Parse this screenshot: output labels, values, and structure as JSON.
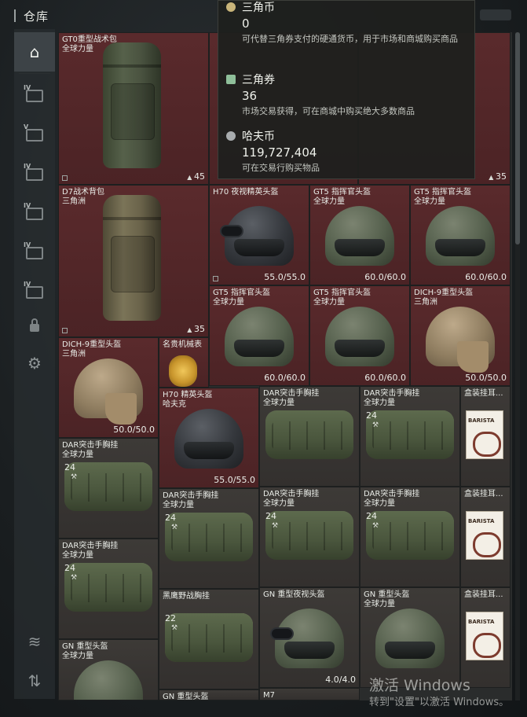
{
  "window": {
    "title": "仓库"
  },
  "sidebar": {
    "items": [
      {
        "name": "home",
        "roman": ""
      },
      {
        "name": "storage-iv-a",
        "roman": "IV"
      },
      {
        "name": "storage-v",
        "roman": "V"
      },
      {
        "name": "storage-iv-b",
        "roman": "IV"
      },
      {
        "name": "storage-iv-c",
        "roman": "IV"
      },
      {
        "name": "storage-iv-d",
        "roman": "IV"
      },
      {
        "name": "storage-iv-e",
        "roman": "IV"
      },
      {
        "name": "lock"
      },
      {
        "name": "settings"
      },
      {
        "name": "layers"
      },
      {
        "name": "sort"
      }
    ]
  },
  "tooltip": {
    "currencies": [
      {
        "name": "三角币",
        "value": "0",
        "desc": "可代替三角券支付的硬通货币，用于市场和商城购买商品",
        "color": "#c9b57a"
      },
      {
        "name": "三角券",
        "value": "36",
        "desc": "市场交易获得，可在商城中购买绝大多数商品",
        "color": "#8fbf9a"
      },
      {
        "name": "哈夫币",
        "value": "119,727,404",
        "desc": "可在交易行购买物品",
        "color": "#a8acae"
      }
    ]
  },
  "items": [
    {
      "name": "GT0重型战术包",
      "sub": "全球力量",
      "stat": "45",
      "type": "backpack"
    },
    {
      "name": "D7战术背包",
      "sub": "三角洲",
      "stat": "35",
      "type": "backpack"
    },
    {
      "name": "H70 夜视精英头盔",
      "sub": "",
      "stat": "55.0/55.0",
      "type": "helmet"
    },
    {
      "name": "GT5 指挥官头盔",
      "sub": "全球力量",
      "stat": "60.0/60.0",
      "type": "helmet"
    },
    {
      "name": "GT5 指挥官头盔",
      "sub": "全球力量",
      "stat": "60.0/60.0",
      "type": "helmet"
    },
    {
      "name": "GT5 指挥官头盔",
      "sub": "全球力量",
      "stat": "60.0/60.0",
      "type": "helmet"
    },
    {
      "name": "GT5 指挥官头盔",
      "sub": "全球力量",
      "stat": "60.0/60.0",
      "type": "helmet"
    },
    {
      "name": "DICH-9重型头盔",
      "sub": "三角洲",
      "stat": "50.0/50.0",
      "type": "helmet"
    },
    {
      "name": "DICH-9重型头盔",
      "sub": "三角洲",
      "stat": "50.0/50.0",
      "type": "helmet"
    },
    {
      "name": "名贵机械表",
      "sub": "",
      "stat": "",
      "type": "watch"
    },
    {
      "name": "H70 精英头盔",
      "sub": "哈夫克",
      "stat": "55.0/55.0",
      "type": "helmet"
    },
    {
      "name": "DAR突击手胸挂",
      "sub": "全球力量",
      "stat": "24",
      "type": "vest"
    },
    {
      "name": "盒装挂耳...",
      "sub": "",
      "stat": "",
      "type": "coffee"
    },
    {
      "name": "GN 重型夜视头盔",
      "sub": "",
      "stat": "4.0/4.0",
      "type": "helmet"
    },
    {
      "name": "GN 重型头盔",
      "sub": "全球力量",
      "stat": "",
      "type": "helmet"
    },
    {
      "name": "黑鹰野战胸挂",
      "sub": "",
      "stat": "22",
      "type": "vest"
    },
    {
      "name": "M7",
      "sub": "",
      "stat": "",
      "type": "other"
    }
  ],
  "watermark": {
    "line1": "激活 Windows",
    "line2": "转到\"设置\"以激活 Windows。"
  },
  "top_right_stat": "35"
}
